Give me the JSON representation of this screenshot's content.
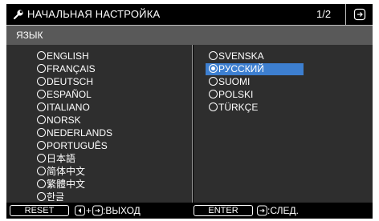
{
  "header": {
    "title": "НАЧАЛЬНАЯ НАСТРОЙКА",
    "page": "1/2",
    "title_icon": "settings-wrench-icon",
    "exit_icon": "exit-menu-icon"
  },
  "section": {
    "label": "ЯЗЫК"
  },
  "languages": {
    "left": [
      "ENGLISH",
      "FRANÇAIS",
      "DEUTSCH",
      "ESPAÑOL",
      "ITALIANO",
      "NORSK",
      "NEDERLANDS",
      "PORTUGUÊS",
      "日本語",
      "简体中文",
      "繁體中文",
      "한글"
    ],
    "right": [
      "SVENSKA",
      "РУССКИЙ",
      "SUOMI",
      "POLSKI",
      "TÜRKÇE"
    ],
    "selected": "РУССКИЙ"
  },
  "footer": {
    "reset_label": "RESET",
    "exit_text": ":ВЫХОД",
    "enter_label": "ENTER",
    "next_text": ":СЛЕД."
  },
  "colors": {
    "background": "#000000",
    "panel": "#2e2e2e",
    "section_bar": "#595959",
    "selection": "#3d7fd0",
    "text": "#ffffff"
  }
}
